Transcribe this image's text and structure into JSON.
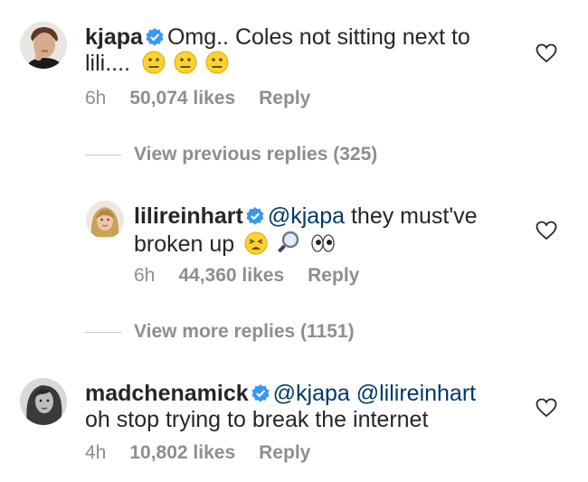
{
  "comments": [
    {
      "username": "kjapa",
      "text": "Omg.. Coles not sitting next to lili....",
      "emojis": [
        "neutral-face",
        "neutral-face",
        "neutral-face"
      ],
      "time": "6h",
      "likes": "50,074 likes",
      "reply_label": "Reply"
    },
    {
      "username": "lilireinhart",
      "mention": "@kjapa",
      "text": "they must've broken up",
      "emojis": [
        "tired-face",
        "magnifying-glass",
        "eyes"
      ],
      "time": "6h",
      "likes": "44,360 likes",
      "reply_label": "Reply"
    },
    {
      "username": "madchenamick",
      "mention": "@kjapa",
      "mention2": "@lilireinhart",
      "text": "oh stop trying to break the internet",
      "time": "4h",
      "likes": "10,802 likes",
      "reply_label": "Reply"
    }
  ],
  "view_previous": "View previous replies (325)",
  "view_more": "View more replies (1151)",
  "colors": {
    "verified": "#3897f0",
    "meta": "#8e8e8e",
    "mention": "#00376b"
  }
}
